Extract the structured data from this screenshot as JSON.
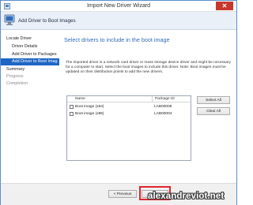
{
  "window": {
    "title": "Import New Driver Wizard",
    "close_symbol": "✕"
  },
  "header": {
    "title": "Add Driver to Boot Images"
  },
  "nav": {
    "items": [
      {
        "label": "Locate Driver",
        "state": "normal"
      },
      {
        "label": "Driver Details",
        "state": "normal"
      },
      {
        "label": "Add Driver to Packages",
        "state": "normal"
      },
      {
        "label": "Add Driver to Boot Imag",
        "state": "active"
      },
      {
        "label": "Summary",
        "state": "normal"
      },
      {
        "label": "Progress",
        "state": "disabled"
      },
      {
        "label": "Completion",
        "state": "disabled"
      }
    ]
  },
  "main": {
    "heading": "Select drivers to include in the boot image",
    "description": "The imported driver is a network card driver or mass storage device driver and might be necessary for a computer to start. Select the boot images to include this driver. Note: Boot images must be updated on their distribution points to add the new drivers.",
    "table": {
      "columns": [
        "Name",
        "Package ID"
      ],
      "rows": [
        {
          "name": "Boot image (x64)",
          "package_id": "LAB00005",
          "checked": false
        },
        {
          "name": "Boot image (x86)",
          "package_id": "LAB00004",
          "checked": false
        }
      ]
    },
    "select_all_label": "Select All",
    "clear_all_label": "Clear All"
  },
  "footer": {
    "previous_label": "< Previous",
    "next_label": "Next >",
    "watermark": "alexandreviot.net"
  },
  "colors": {
    "accent": "#1f66c4",
    "heading": "#2f6cbd",
    "close": "#c7372d",
    "highlight": "#e0262e"
  }
}
